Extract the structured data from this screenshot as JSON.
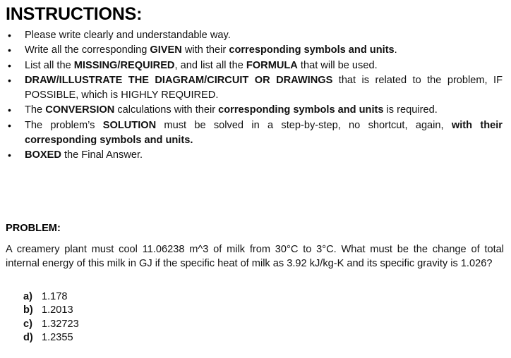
{
  "document": {
    "title": "INSTRUCTIONS:",
    "problem_heading": "PROBLEM:"
  },
  "instructions": {
    "bullet_glyph": "•",
    "items": [
      {
        "id": "write-clearly",
        "parts": [
          {
            "text": "Please write clearly and understandable way.",
            "bold": false
          }
        ]
      },
      {
        "id": "given-symbols-units",
        "parts": [
          {
            "text": "Write all the corresponding ",
            "bold": false
          },
          {
            "text": "GIVEN",
            "bold": true
          },
          {
            "text": " with their ",
            "bold": false
          },
          {
            "text": "corresponding symbols and units",
            "bold": true
          },
          {
            "text": ".",
            "bold": false
          }
        ]
      },
      {
        "id": "missing-required-formula",
        "parts": [
          {
            "text": "List all the ",
            "bold": false
          },
          {
            "text": "MISSING/REQUIRED",
            "bold": true
          },
          {
            "text": ", and list all the ",
            "bold": false
          },
          {
            "text": "FORMULA",
            "bold": true
          },
          {
            "text": " that will be used.",
            "bold": false
          }
        ]
      },
      {
        "id": "draw-illustrate-diagram",
        "parts": [
          {
            "text": "DRAW/ILLUSTRATE THE DIAGRAM/CIRCUIT OR DRAWINGS",
            "bold": true
          },
          {
            "text": " that is related to the problem, IF POSSIBLE, which is HIGHLY REQUIRED.",
            "bold": false
          }
        ]
      },
      {
        "id": "conversion-calculations",
        "parts": [
          {
            "text": "The ",
            "bold": false
          },
          {
            "text": "CONVERSION",
            "bold": true
          },
          {
            "text": " calculations with their ",
            "bold": false
          },
          {
            "text": "corresponding symbols and units",
            "bold": true
          },
          {
            "text": " is required.",
            "bold": false
          }
        ]
      },
      {
        "id": "solution-step-by-step",
        "parts": [
          {
            "text": "The problem’s ",
            "bold": false
          },
          {
            "text": "SOLUTION",
            "bold": true
          },
          {
            "text": " must be solved in a step-by-step, no shortcut, again, ",
            "bold": false
          },
          {
            "text": "with their corresponding symbols and units.",
            "bold": true
          }
        ]
      },
      {
        "id": "boxed-final-answer",
        "parts": [
          {
            "text": "BOXED",
            "bold": true
          },
          {
            "text": " the Final Answer.",
            "bold": false
          }
        ]
      }
    ]
  },
  "problem": {
    "text": "A creamery plant must cool 11.06238 m^3 of milk from 30°C to 3°C. What must be the change of total internal energy of this milk in GJ if the specific heat of milk as 3.92 kJ/kg-K and its specific gravity is 1.026?",
    "volume": "11.06238 m^3",
    "initial_temperature": "30°C",
    "final_temperature": "3°C",
    "specific_heat": "3.92 kJ/kg-K",
    "specific_gravity": "1.026",
    "answer_unit": "GJ",
    "options": [
      {
        "label": "a)",
        "value": "1.178"
      },
      {
        "label": "b)",
        "value": "1.2013"
      },
      {
        "label": "c)",
        "value": "1.32723"
      },
      {
        "label": "d)",
        "value": "1.2355"
      }
    ]
  },
  "colors": {
    "background": "#ffffff",
    "text": "#111111",
    "heading": "#000000"
  }
}
